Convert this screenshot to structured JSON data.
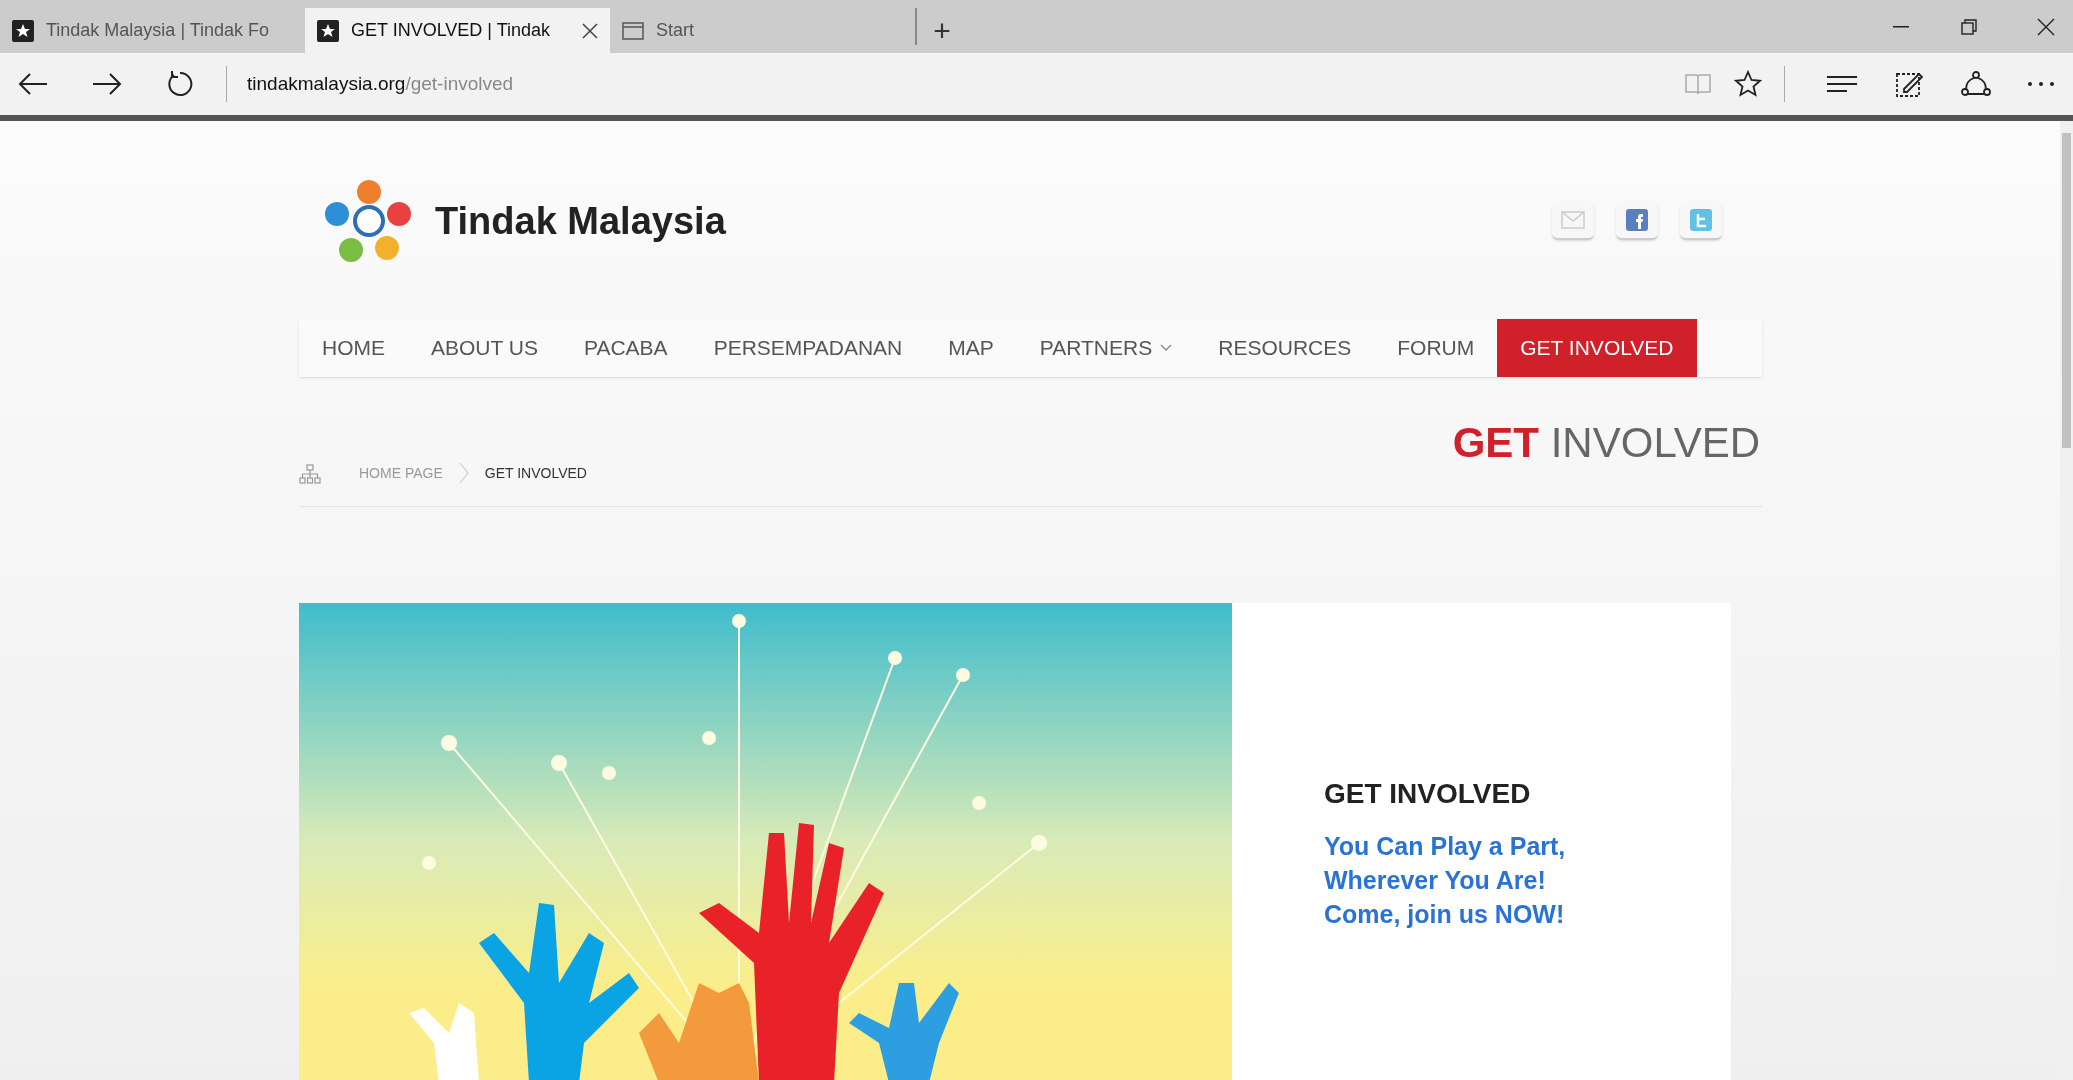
{
  "browser": {
    "tabs": [
      {
        "title": "Tindak Malaysia | Tindak Fo",
        "kind": "site",
        "selected": false,
        "closable": false
      },
      {
        "title": "GET INVOLVED | Tindak",
        "kind": "site",
        "selected": true,
        "closable": true
      },
      {
        "title": "Start",
        "kind": "page",
        "selected": false,
        "closable": false
      }
    ],
    "new_tab": "+",
    "address": {
      "domain": "tindakmalaysia.org",
      "path": "/get-involved"
    }
  },
  "page": {
    "logo_text": "Tindak Malaysia",
    "nav": [
      {
        "label": "HOME",
        "selected": false,
        "dropdown": false
      },
      {
        "label": "ABOUT US",
        "selected": false,
        "dropdown": false
      },
      {
        "label": "PACABA",
        "selected": false,
        "dropdown": false
      },
      {
        "label": "PERSEMPADANAN",
        "selected": false,
        "dropdown": false
      },
      {
        "label": "MAP",
        "selected": false,
        "dropdown": false
      },
      {
        "label": "PARTNERS",
        "selected": false,
        "dropdown": true
      },
      {
        "label": "RESOURCES",
        "selected": false,
        "dropdown": false
      },
      {
        "label": "FORUM",
        "selected": false,
        "dropdown": false
      },
      {
        "label": "GET INVOLVED",
        "selected": true,
        "dropdown": false
      }
    ],
    "breadcrumb": [
      "HOME PAGE",
      "GET INVOLVED"
    ],
    "title_strong": "GET",
    "title_rest": "INVOLVED",
    "hero": {
      "heading": "GET INVOLVED",
      "tagline": [
        "You Can Play a Part,",
        "Wherever You Are!",
        "Come, join us NOW!"
      ]
    }
  }
}
